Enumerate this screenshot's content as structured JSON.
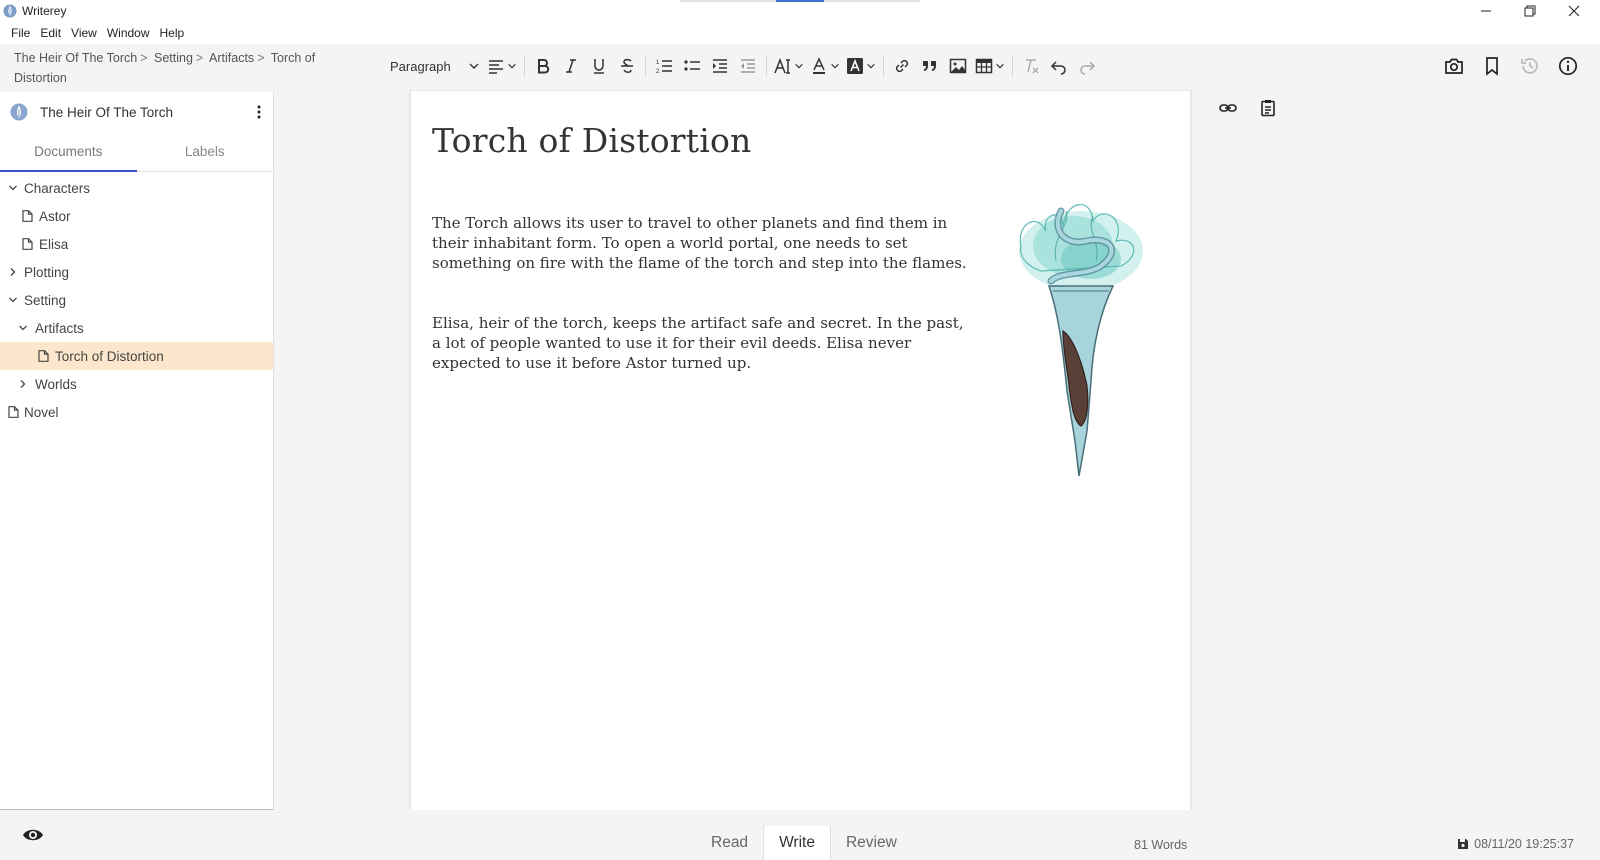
{
  "window": {
    "title": "Writerey",
    "controls": {
      "minimize": "minimize",
      "restore": "restore",
      "close": "close"
    }
  },
  "menu": [
    "File",
    "Edit",
    "View",
    "Window",
    "Help"
  ],
  "breadcrumb": [
    "The Heir Of The Torch",
    "Setting",
    "Artifacts",
    "Torch of Distortion"
  ],
  "toolbar": {
    "paragraph_style": "Paragraph",
    "buttons": [
      "align-icon",
      "bold-icon",
      "italic-icon",
      "underline-icon",
      "strikethrough-icon",
      "ordered-list-icon",
      "bullet-list-icon",
      "indent-icon",
      "outdent-icon",
      "font-size-icon",
      "font-color-icon",
      "highlight-icon",
      "link-icon",
      "quote-icon",
      "image-icon",
      "table-icon",
      "clear-format-icon",
      "undo-icon",
      "redo-icon"
    ],
    "right": [
      "camera-icon",
      "bookmark-icon",
      "history-icon",
      "info-icon"
    ]
  },
  "sidebar": {
    "project_name": "The Heir Of The Torch",
    "tabs": {
      "documents": "Documents",
      "labels": "Labels"
    },
    "tree": [
      {
        "label": "Characters",
        "type": "folder",
        "expanded": true
      },
      {
        "label": "Astor",
        "type": "doc"
      },
      {
        "label": "Elisa",
        "type": "doc"
      },
      {
        "label": "Plotting",
        "type": "folder",
        "expanded": false
      },
      {
        "label": "Setting",
        "type": "folder",
        "expanded": true
      },
      {
        "label": "Artifacts",
        "type": "folder",
        "expanded": true
      },
      {
        "label": "Torch of Distortion",
        "type": "doc",
        "selected": true
      },
      {
        "label": "Worlds",
        "type": "folder",
        "expanded": false
      },
      {
        "label": "Novel",
        "type": "doc"
      }
    ]
  },
  "document": {
    "title": "Torch of Distortion",
    "paragraphs": [
      "The Torch allows its user to travel to other planets and find them in their inhabitant form. To open a world portal, one needs to set something on fire with the flame of the torch and step into the flames.",
      "Elisa, heir of the torch, keeps the artifact safe and secret. In the past, a lot of people wanted to use it for their evil deeds. Elisa never expected to use it before Astor turned up."
    ],
    "image": "torch illustration"
  },
  "side_tools": [
    "link-icon",
    "clipboard-icon"
  ],
  "bottom": {
    "modes": [
      "Read",
      "Write",
      "Review"
    ],
    "active_mode": "Write",
    "word_count": "81 Words",
    "saved_at": "08/11/20 19:25:37"
  },
  "colors": {
    "accent": "#3c56c4",
    "selection": "#fde7cc",
    "torch_flame": "#7fd3d0",
    "torch_handle": "#a8d4dc",
    "torch_grip": "#5b4038"
  }
}
